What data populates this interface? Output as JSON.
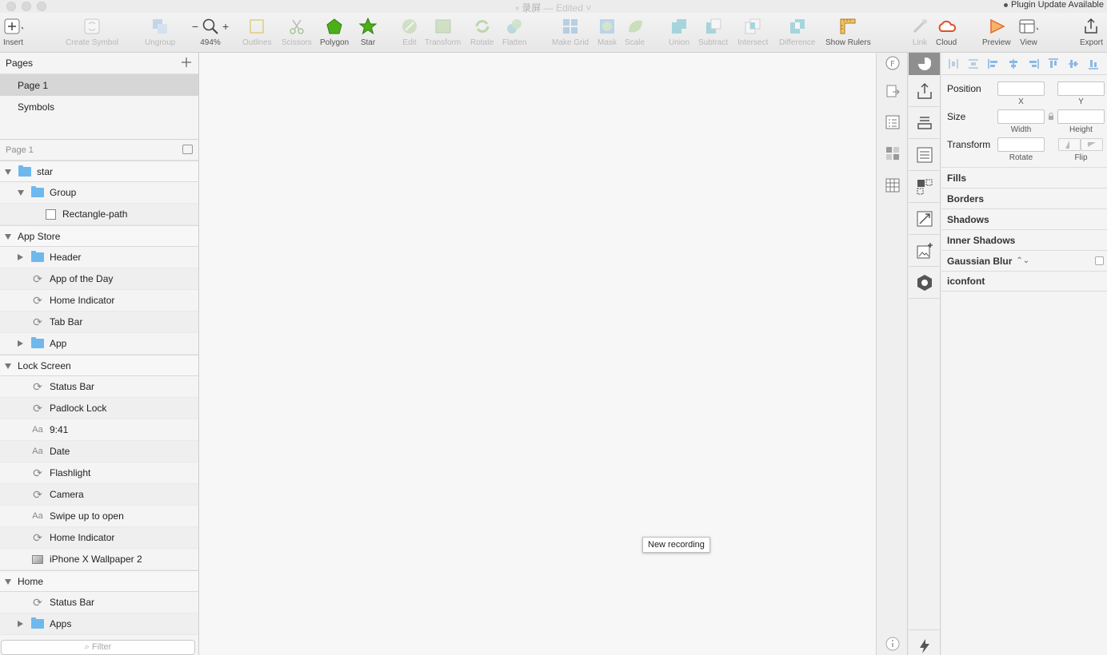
{
  "window": {
    "title": "录屏",
    "title_suffix": "— Edited ˅",
    "plugin_note": "Plugin Update Available"
  },
  "toolbar": {
    "insert": "Insert",
    "create_symbol": "Create Symbol",
    "ungroup": "Ungroup",
    "zoom": "494%",
    "zoom_minus": "−",
    "zoom_plus": "+",
    "outlines": "Outlines",
    "scissors": "Scissors",
    "polygon": "Polygon",
    "star": "Star",
    "edit": "Edit",
    "transform": "Transform",
    "rotate": "Rotate",
    "flatten": "Flatten",
    "make_grid": "Make Grid",
    "mask": "Mask",
    "scale": "Scale",
    "union": "Union",
    "subtract": "Subtract",
    "intersect": "Intersect",
    "difference": "Difference",
    "show_rulers": "Show Rulers",
    "link": "Link",
    "cloud": "Cloud",
    "preview": "Preview",
    "view": "View",
    "export": "Export"
  },
  "pages": {
    "header": "Pages",
    "items": [
      "Page 1",
      "Symbols"
    ],
    "selected": "Page 1"
  },
  "layers": {
    "header": "Page 1",
    "rows": [
      {
        "name": "star",
        "type": "folder",
        "depth": 0,
        "expander": "down",
        "group": true
      },
      {
        "name": "Group",
        "type": "folder",
        "depth": 1,
        "expander": "down"
      },
      {
        "name": "Rectangle-path",
        "type": "rect",
        "depth": 2
      },
      {
        "name": "App Store",
        "type": "artboard",
        "depth": 0,
        "expander": "down",
        "group": true
      },
      {
        "name": "Header",
        "type": "folder",
        "depth": 1,
        "expander": "right"
      },
      {
        "name": "App of the Day",
        "type": "symbol",
        "depth": 1
      },
      {
        "name": "Home Indicator",
        "type": "symbol",
        "depth": 1
      },
      {
        "name": "Tab Bar",
        "type": "symbol",
        "depth": 1
      },
      {
        "name": "App",
        "type": "folder",
        "depth": 1,
        "expander": "right"
      },
      {
        "name": "Lock Screen",
        "type": "artboard",
        "depth": 0,
        "expander": "down",
        "group": true
      },
      {
        "name": "Status Bar",
        "type": "symbol",
        "depth": 1
      },
      {
        "name": "Padlock Lock",
        "type": "symbol",
        "depth": 1
      },
      {
        "name": "9:41",
        "type": "text",
        "depth": 1
      },
      {
        "name": "Date",
        "type": "text",
        "depth": 1
      },
      {
        "name": "Flashlight",
        "type": "symbol",
        "depth": 1
      },
      {
        "name": "Camera",
        "type": "symbol",
        "depth": 1
      },
      {
        "name": "Swipe up to open",
        "type": "text",
        "depth": 1
      },
      {
        "name": "Home Indicator",
        "type": "symbol",
        "depth": 1
      },
      {
        "name": "iPhone X Wallpaper 2",
        "type": "image",
        "depth": 1
      },
      {
        "name": "Home",
        "type": "artboard",
        "depth": 0,
        "expander": "down",
        "group": true
      },
      {
        "name": "Status Bar",
        "type": "symbol",
        "depth": 1
      },
      {
        "name": "Apps",
        "type": "folder",
        "depth": 1,
        "expander": "right"
      }
    ],
    "text_icon": "Aa",
    "filter_placeholder": "Filter"
  },
  "canvas": {
    "tooltip": "New recording"
  },
  "inspector": {
    "position": "Position",
    "x": "X",
    "y": "Y",
    "size": "Size",
    "width": "Width",
    "height": "Height",
    "transform": "Transform",
    "rotate": "Rotate",
    "flip": "Flip",
    "sections": [
      "Fills",
      "Borders",
      "Shadows",
      "Inner Shadows",
      "Gaussian Blur",
      "iconfont"
    ]
  },
  "colors": {
    "folder": "#6fb8ee",
    "polygon": "#4caf1a",
    "preview": "#e8692b",
    "cloud": "#d9532b"
  }
}
